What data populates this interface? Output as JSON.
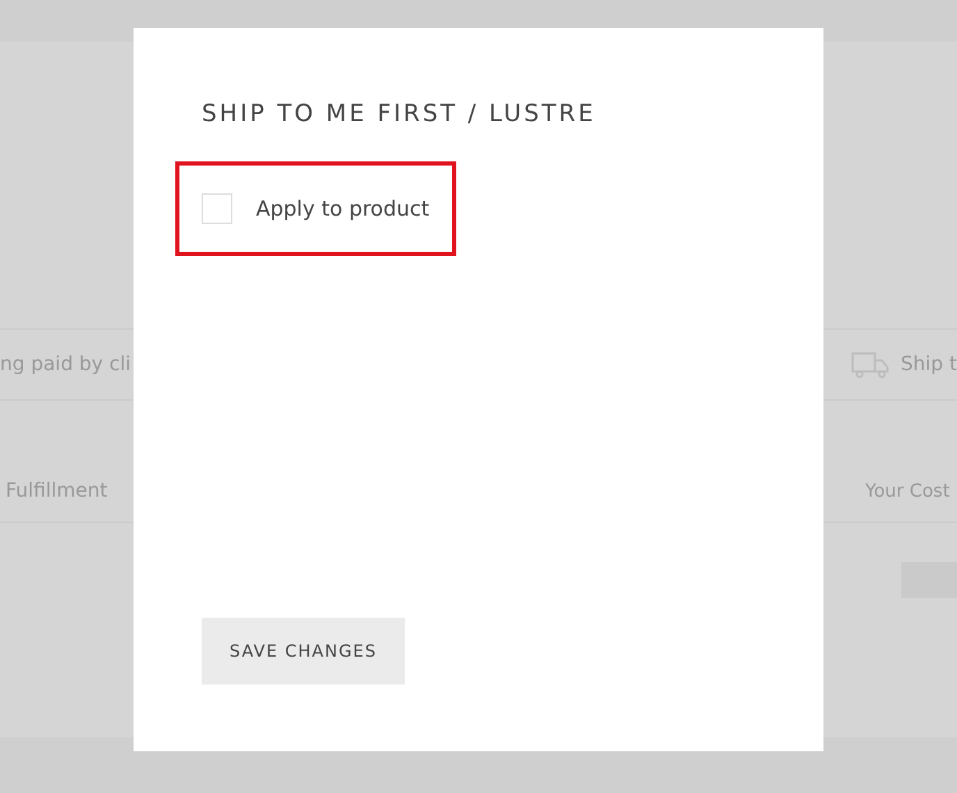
{
  "background": {
    "row_1": {
      "left_text": "ng paid by cli",
      "right_text": "Ship t"
    },
    "row_2": {
      "left_text": "Fulfillment",
      "right_text": "Your Cost"
    }
  },
  "dialog": {
    "title": "SHIP TO ME FIRST / LUSTRE",
    "option": {
      "label": "Apply to product",
      "checked": false,
      "highlighted": true
    },
    "save_button": "SAVE CHANGES"
  }
}
